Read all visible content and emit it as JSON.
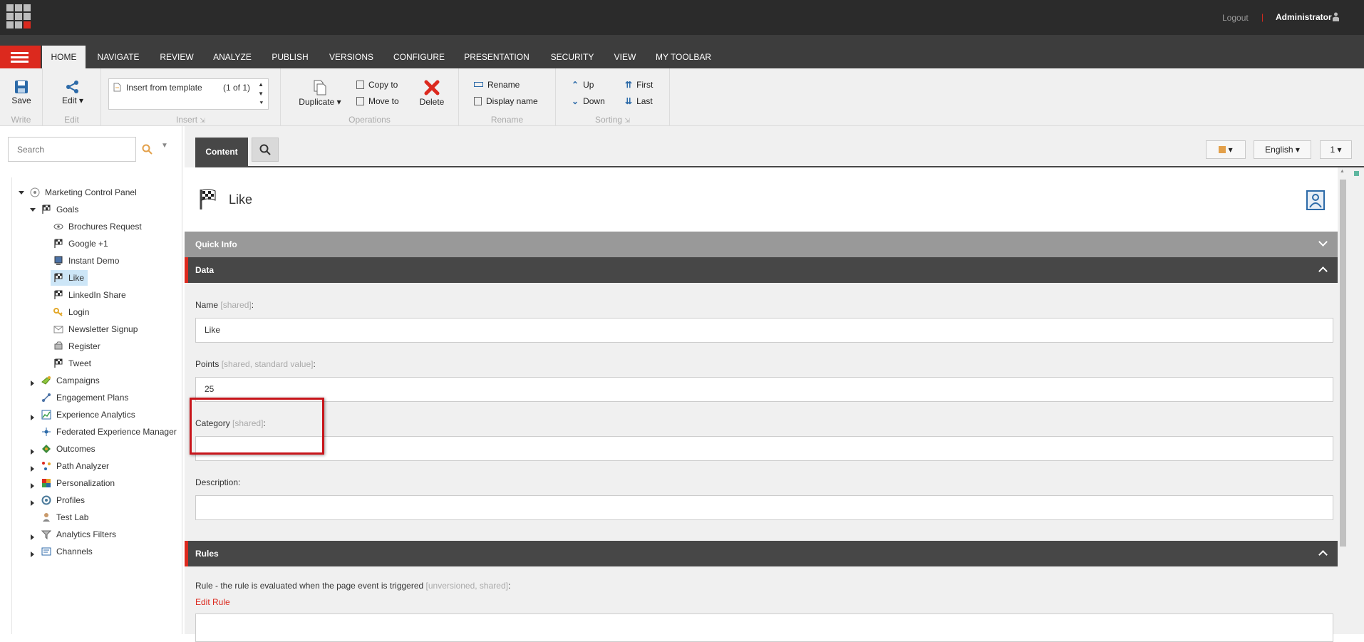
{
  "header": {
    "logout_label": "Logout",
    "separator": "|",
    "user_name": "Administrator"
  },
  "ribbon_tabs": [
    "HOME",
    "NAVIGATE",
    "REVIEW",
    "ANALYZE",
    "PUBLISH",
    "VERSIONS",
    "CONFIGURE",
    "PRESENTATION",
    "SECURITY",
    "VIEW",
    "MY TOOLBAR"
  ],
  "ribbon": {
    "write": {
      "save_label": "Save",
      "group_label": "Write"
    },
    "edit": {
      "edit_label": "Edit",
      "group_label": "Edit"
    },
    "insert": {
      "item_label": "Insert from template",
      "count": "(1 of 1)",
      "group_label": "Insert"
    },
    "operations": {
      "duplicate_label": "Duplicate",
      "copy_to_label": "Copy to",
      "move_to_label": "Move to",
      "delete_label": "Delete",
      "group_label": "Operations"
    },
    "rename": {
      "rename_label": "Rename",
      "display_name_label": "Display name",
      "group_label": "Rename"
    },
    "sorting": {
      "up_label": "Up",
      "down_label": "Down",
      "first_label": "First",
      "last_label": "Last",
      "group_label": "Sorting"
    }
  },
  "search": {
    "placeholder": "Search"
  },
  "tree": {
    "root": "Marketing Control Panel",
    "goals": "Goals",
    "goal_items": [
      "Brochures Request",
      "Google +1",
      "Instant Demo",
      "Like",
      "LinkedIn Share",
      "Login",
      "Newsletter Signup",
      "Register",
      "Tweet"
    ],
    "sections": [
      "Campaigns",
      "Engagement Plans",
      "Experience Analytics",
      "Federated Experience Manager",
      "Outcomes",
      "Path Analyzer",
      "Personalization",
      "Profiles",
      "Test Lab",
      "Analytics Filters",
      "Channels"
    ]
  },
  "content": {
    "tab_label": "Content",
    "language": "English",
    "version": "1",
    "item_title": "Like",
    "quick_info_label": "Quick Info",
    "data_section_label": "Data",
    "fields": {
      "name": {
        "label": "Name",
        "meta": "[shared]",
        "value": "Like"
      },
      "points": {
        "label": "Points",
        "meta": "[shared, standard value]",
        "value": "25"
      },
      "category": {
        "label": "Category",
        "meta": "[shared]",
        "value": ""
      },
      "description": {
        "label": "Description:",
        "value": ""
      }
    },
    "rules_section_label": "Rules",
    "rule_label": "Rule - the rule is evaluated when the page event is triggered",
    "rule_meta": "[unversioned, shared]",
    "edit_rule_label": "Edit Rule"
  },
  "colors": {
    "accent": "#dc291e",
    "section_dark": "#474747",
    "section_grey": "#999999",
    "selection": "#cde6f7"
  }
}
